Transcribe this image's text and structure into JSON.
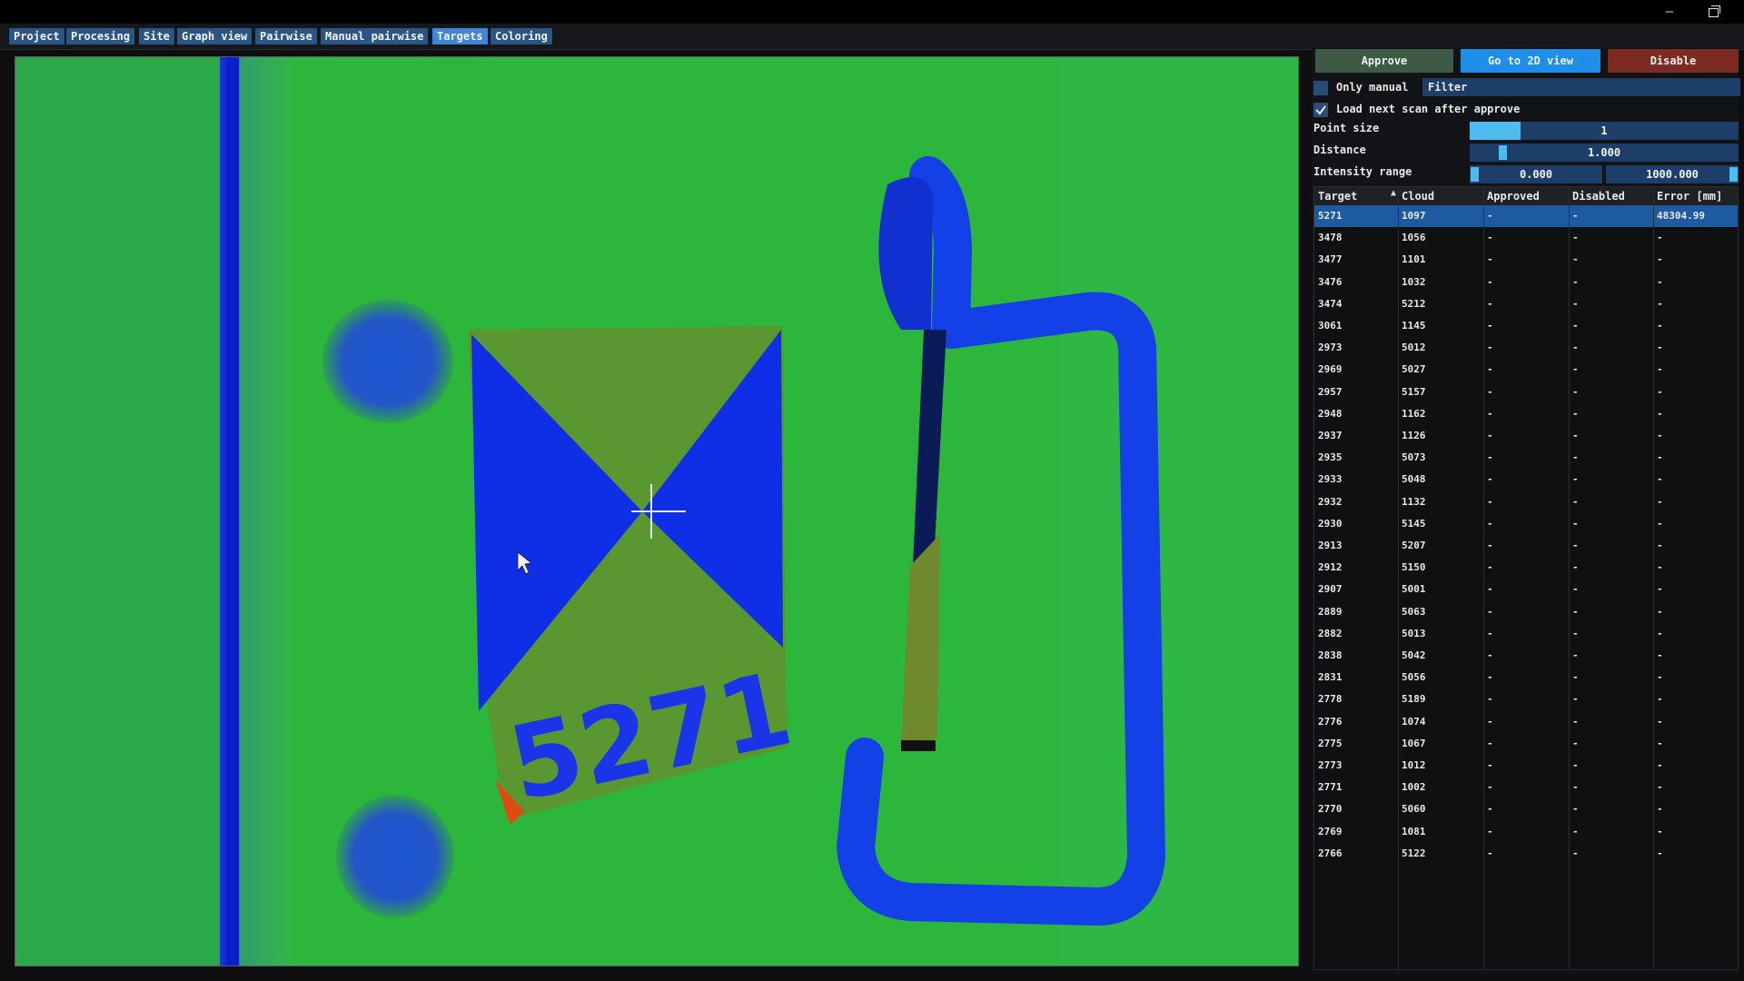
{
  "menu": {
    "tabs": [
      {
        "label": "Project",
        "active": false
      },
      {
        "label": "Procesing",
        "active": false
      },
      {
        "label": "Site",
        "active": false
      },
      {
        "label": "Graph view",
        "active": false
      },
      {
        "label": "Pairwise",
        "active": false
      },
      {
        "label": "Manual pairwise",
        "active": false
      },
      {
        "label": "Targets",
        "active": true
      },
      {
        "label": "Coloring",
        "active": false
      }
    ]
  },
  "viewport": {
    "target_label": "5271",
    "colors": {
      "background": "#28b83a",
      "low": "#0f2fe6",
      "mid": "#5f9a2e",
      "high": "#e04a12"
    }
  },
  "panel": {
    "buttons": {
      "approve": "Approve",
      "go_2d": "Go to 2D view",
      "disable": "Disable"
    },
    "only_manual": {
      "label": "Only manual",
      "checked": false
    },
    "filter": {
      "value": "Filter"
    },
    "load_next": {
      "label": "Load next scan after approve",
      "checked": true
    },
    "settings": {
      "point_size": {
        "label": "Point size",
        "value": "1",
        "fraction": 0.19
      },
      "distance": {
        "label": "Distance",
        "value": "1.000",
        "fraction": 0.12
      },
      "intensity": {
        "label": "Intensity range",
        "min": "0.000",
        "max": "1000.000"
      }
    }
  },
  "table": {
    "headers": {
      "target": "Target",
      "cloud": "Cloud",
      "approved": "Approved",
      "disabled": "Disabled",
      "error": "Error [mm]"
    },
    "selected_index": 0,
    "rows": [
      {
        "target": "5271",
        "cloud": "1097",
        "approved": "-",
        "disabled": "-",
        "error": "48304.99"
      },
      {
        "target": "3478",
        "cloud": "1056",
        "approved": "-",
        "disabled": "-",
        "error": "-"
      },
      {
        "target": "3477",
        "cloud": "1101",
        "approved": "-",
        "disabled": "-",
        "error": "-"
      },
      {
        "target": "3476",
        "cloud": "1032",
        "approved": "-",
        "disabled": "-",
        "error": "-"
      },
      {
        "target": "3474",
        "cloud": "5212",
        "approved": "-",
        "disabled": "-",
        "error": "-"
      },
      {
        "target": "3061",
        "cloud": "1145",
        "approved": "-",
        "disabled": "-",
        "error": "-"
      },
      {
        "target": "2973",
        "cloud": "5012",
        "approved": "-",
        "disabled": "-",
        "error": "-"
      },
      {
        "target": "2969",
        "cloud": "5027",
        "approved": "-",
        "disabled": "-",
        "error": "-"
      },
      {
        "target": "2957",
        "cloud": "5157",
        "approved": "-",
        "disabled": "-",
        "error": "-"
      },
      {
        "target": "2948",
        "cloud": "1162",
        "approved": "-",
        "disabled": "-",
        "error": "-"
      },
      {
        "target": "2937",
        "cloud": "1126",
        "approved": "-",
        "disabled": "-",
        "error": "-"
      },
      {
        "target": "2935",
        "cloud": "5073",
        "approved": "-",
        "disabled": "-",
        "error": "-"
      },
      {
        "target": "2933",
        "cloud": "5048",
        "approved": "-",
        "disabled": "-",
        "error": "-"
      },
      {
        "target": "2932",
        "cloud": "1132",
        "approved": "-",
        "disabled": "-",
        "error": "-"
      },
      {
        "target": "2930",
        "cloud": "5145",
        "approved": "-",
        "disabled": "-",
        "error": "-"
      },
      {
        "target": "2913",
        "cloud": "5207",
        "approved": "-",
        "disabled": "-",
        "error": "-"
      },
      {
        "target": "2912",
        "cloud": "5150",
        "approved": "-",
        "disabled": "-",
        "error": "-"
      },
      {
        "target": "2907",
        "cloud": "5001",
        "approved": "-",
        "disabled": "-",
        "error": "-"
      },
      {
        "target": "2889",
        "cloud": "5063",
        "approved": "-",
        "disabled": "-",
        "error": "-"
      },
      {
        "target": "2882",
        "cloud": "5013",
        "approved": "-",
        "disabled": "-",
        "error": "-"
      },
      {
        "target": "2838",
        "cloud": "5042",
        "approved": "-",
        "disabled": "-",
        "error": "-"
      },
      {
        "target": "2831",
        "cloud": "5056",
        "approved": "-",
        "disabled": "-",
        "error": "-"
      },
      {
        "target": "2778",
        "cloud": "5189",
        "approved": "-",
        "disabled": "-",
        "error": "-"
      },
      {
        "target": "2776",
        "cloud": "1074",
        "approved": "-",
        "disabled": "-",
        "error": "-"
      },
      {
        "target": "2775",
        "cloud": "1067",
        "approved": "-",
        "disabled": "-",
        "error": "-"
      },
      {
        "target": "2773",
        "cloud": "1012",
        "approved": "-",
        "disabled": "-",
        "error": "-"
      },
      {
        "target": "2771",
        "cloud": "1002",
        "approved": "-",
        "disabled": "-",
        "error": "-"
      },
      {
        "target": "2770",
        "cloud": "5060",
        "approved": "-",
        "disabled": "-",
        "error": "-"
      },
      {
        "target": "2769",
        "cloud": "1081",
        "approved": "-",
        "disabled": "-",
        "error": "-"
      },
      {
        "target": "2766",
        "cloud": "5122",
        "approved": "-",
        "disabled": "-",
        "error": "-"
      }
    ]
  }
}
